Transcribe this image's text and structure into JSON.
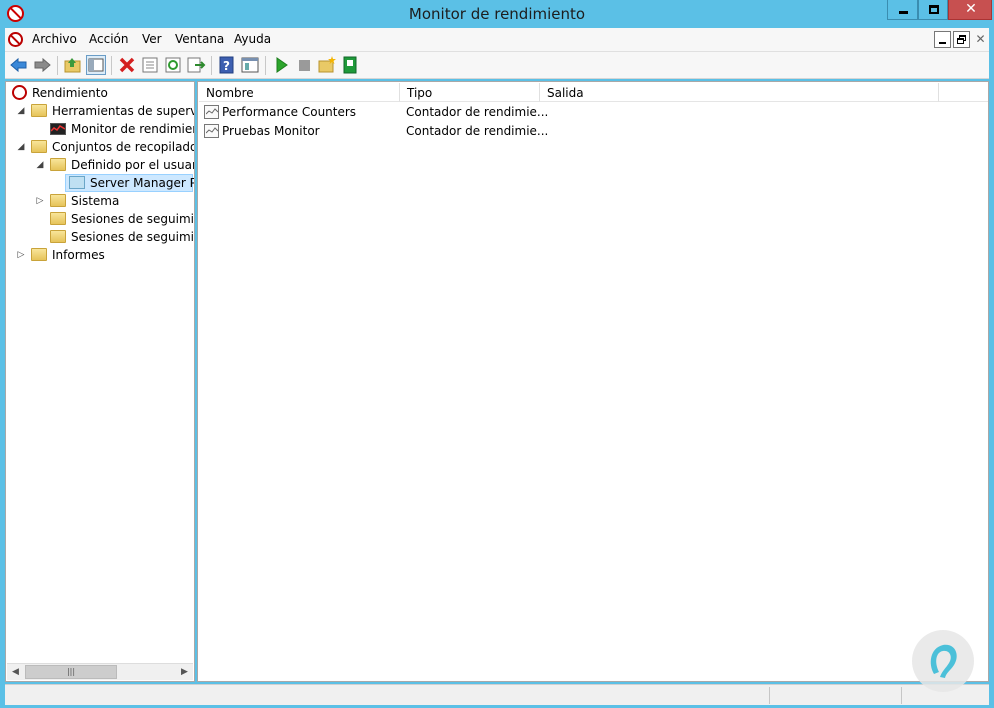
{
  "window": {
    "title": "Monitor de rendimiento"
  },
  "menu": {
    "items": [
      "Archivo",
      "Acción",
      "Ver",
      "Ventana",
      "Ayuda"
    ]
  },
  "tree": {
    "items": [
      {
        "label": "Rendimiento"
      },
      {
        "label": "Herramientas de supervisión"
      },
      {
        "label": "Monitor de rendimiento"
      },
      {
        "label": "Conjuntos de recopiladores"
      },
      {
        "label": "Definido por el usuario"
      },
      {
        "label": "Server Manager Performance"
      },
      {
        "label": "Sistema"
      },
      {
        "label": "Sesiones de seguimiento"
      },
      {
        "label": "Sesiones de seguimiento"
      },
      {
        "label": "Informes"
      }
    ]
  },
  "list": {
    "columns": [
      "Nombre",
      "Tipo",
      "Salida"
    ],
    "rows": [
      {
        "name": "Performance Counters",
        "type": "Contador de rendimie..."
      },
      {
        "name": "Pruebas Monitor",
        "type": "Contador de rendimie..."
      }
    ]
  },
  "colors": {
    "title_bar": "#5bc0e6",
    "close_button": "#c75050",
    "selection": "#cde8ff"
  }
}
